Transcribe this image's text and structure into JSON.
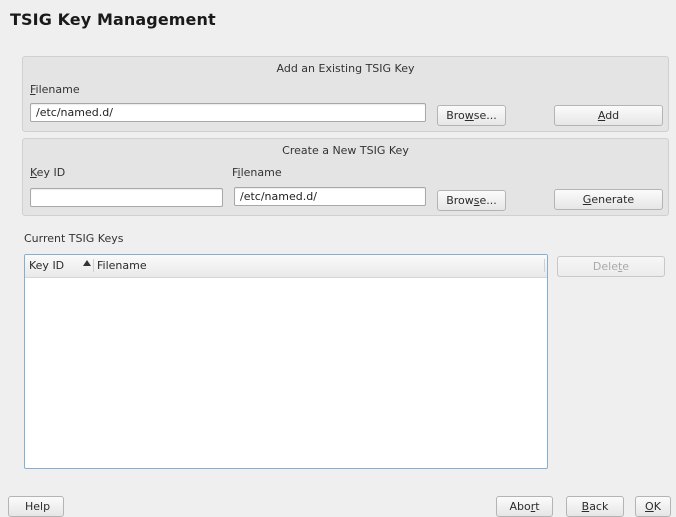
{
  "page": {
    "title": "TSIG Key Management"
  },
  "add_existing": {
    "group_title": "Add an Existing TSIG Key",
    "filename_label_mnemonic": "F",
    "filename_label_rest": "ilename",
    "filename_value": "/etc/named.d/",
    "browse_pre": "Bro",
    "browse_mnemonic": "w",
    "browse_post": "se...",
    "add_mnemonic": "A",
    "add_rest": "dd"
  },
  "create_new": {
    "group_title": "Create a New TSIG Key",
    "keyid_label_mnemonic": "K",
    "keyid_label_rest": "ey ID",
    "keyid_value": "",
    "filename_label_pre": "F",
    "filename_label_mnemonic": "i",
    "filename_label_post": "lename",
    "filename_value": "/etc/named.d/",
    "browse_pre": "Brow",
    "browse_mnemonic": "s",
    "browse_post": "e...",
    "generate_mnemonic": "G",
    "generate_rest": "enerate"
  },
  "current_keys": {
    "label": "Current TSIG Keys",
    "columns": [
      "Key ID",
      "Filename"
    ],
    "sort_icon": "chevron-up-icon",
    "rows": [],
    "delete_pre": "Dele",
    "delete_mnemonic": "t",
    "delete_post": "e"
  },
  "footer": {
    "help": "Help",
    "abort_pre": "Abo",
    "abort_mnemonic": "r",
    "abort_post": "t",
    "back_mnemonic": "B",
    "back_rest": "ack",
    "ok_mnemonic": "O",
    "ok_rest": "K"
  },
  "colors": {
    "table_border": "#86aed3",
    "background": "#efefef"
  }
}
